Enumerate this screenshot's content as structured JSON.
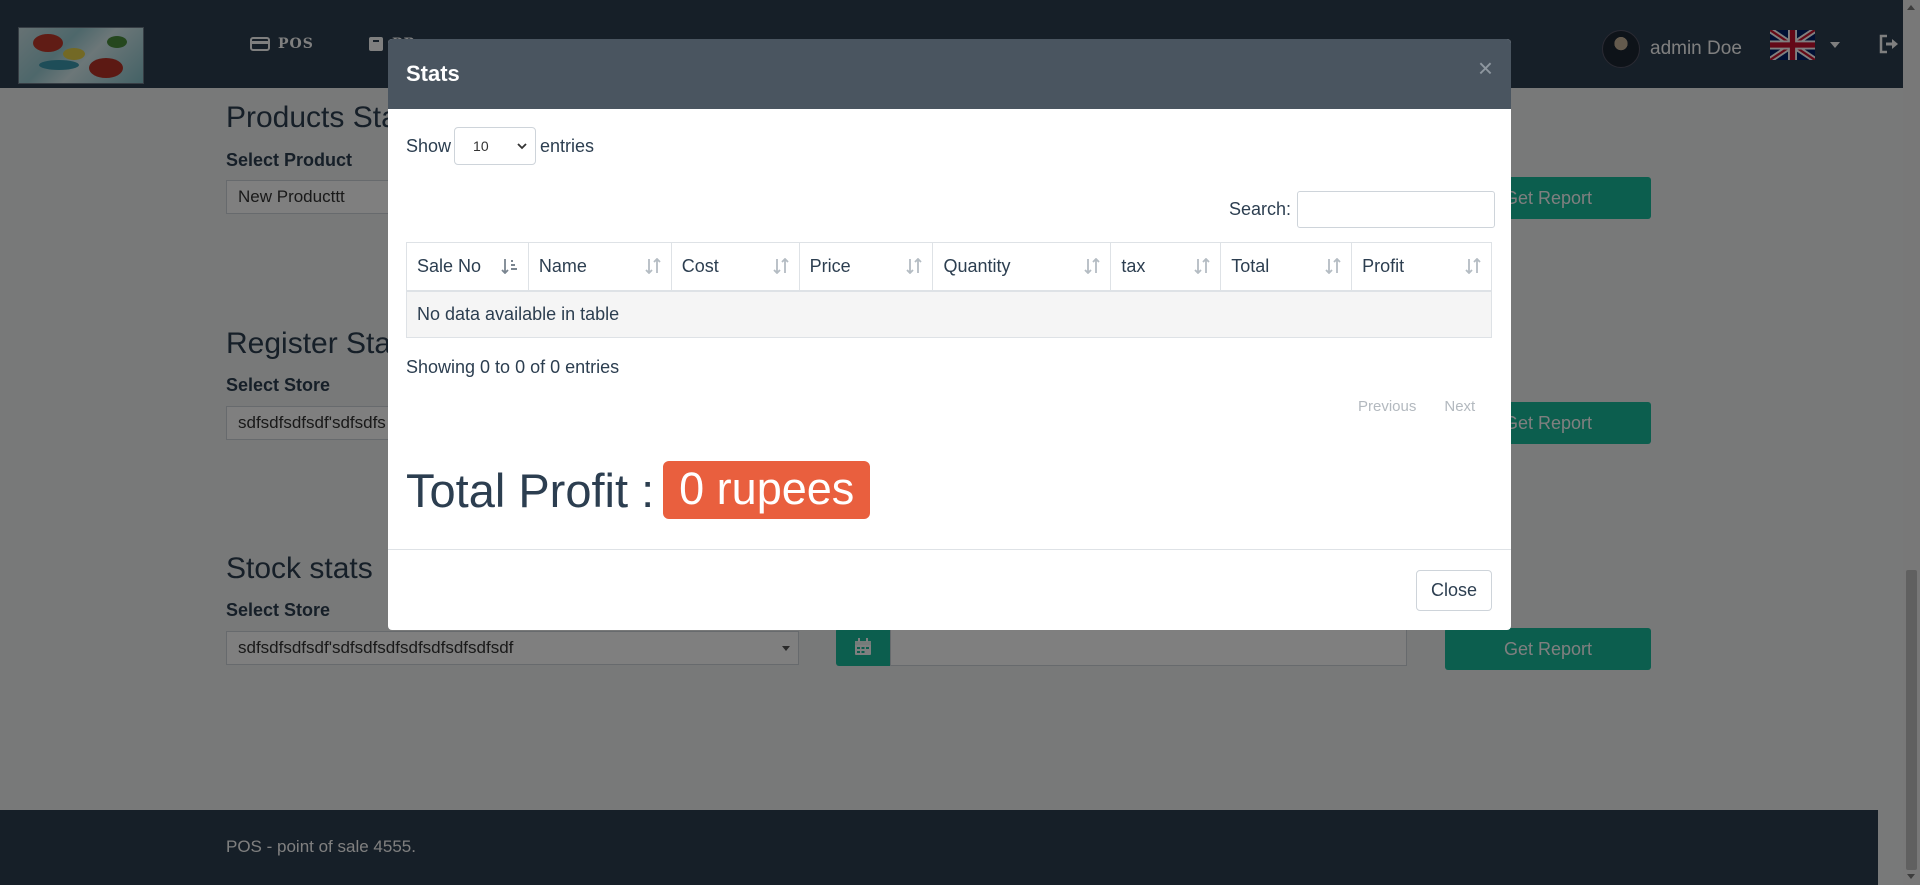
{
  "navbar": {
    "items": [
      {
        "icon": "credit-card-icon",
        "label": "POS"
      },
      {
        "icon": "box-icon",
        "label": "PR"
      }
    ],
    "user_name": "admin Doe",
    "language_flag": "uk-flag-icon"
  },
  "page": {
    "sections": [
      {
        "title": "Products Stats",
        "label": "Select Product",
        "value": "New Producttt",
        "button": "Get Report"
      },
      {
        "title": "Register Stats",
        "label": "Select Store",
        "value": "sdfsdfsdfsdf'sdfsdfs",
        "button": "Get Report"
      },
      {
        "title": "Stock stats",
        "label": "Select Store",
        "value": "sdfsdfsdfsdf'sdfsdfsdfsdfsdfsdfsdfsdf",
        "button": "Get Report"
      }
    ],
    "footer_text": "POS - point of sale 4555."
  },
  "modal": {
    "title": "Stats",
    "close_symbol": "×",
    "show_label": "Show",
    "entries_label": "entries",
    "page_length": "10",
    "search_label": "Search:",
    "columns": [
      "Sale No",
      "Name",
      "Cost",
      "Price",
      "Quantity",
      "tax",
      "Total",
      "Profit"
    ],
    "empty_message": "No data available in table",
    "info": "Showing 0 to 0 of 0 entries",
    "pagination": {
      "previous": "Previous",
      "next": "Next"
    },
    "profit_label": "Total Profit :",
    "profit_value": "0 rupees",
    "close_button": "Close"
  },
  "colors": {
    "navbar": "#2c3e50",
    "accent": "#18bc9c",
    "badge": "#e95f3e",
    "modal_header": "#4a5560"
  }
}
